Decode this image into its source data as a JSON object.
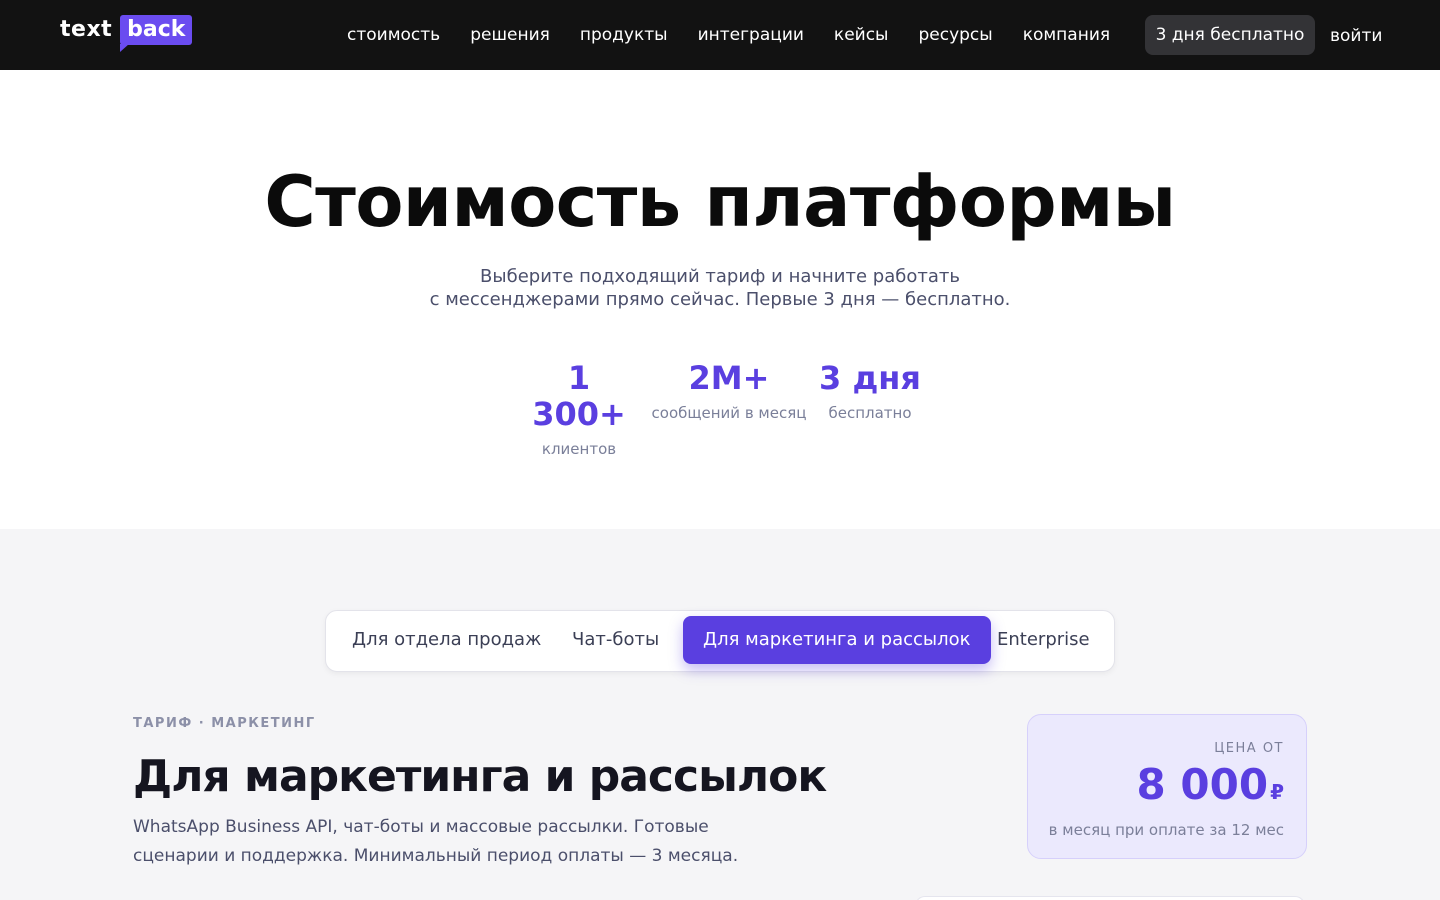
{
  "header": {
    "logo_text": "text",
    "logo_highlight": "back",
    "nav": [
      "стоимость",
      "решения",
      "продукты",
      "интеграции",
      "кейсы",
      "ресурсы",
      "компания"
    ],
    "trial_button": "3 дня бесплатно",
    "login": "войти"
  },
  "hero": {
    "title": "Стоимость платформы",
    "subtitle_line1": "Выберите подходящий тариф и начните работать",
    "subtitle_line2": "с мессенджерами прямо сейчас. Первые 3 дня — бесплатно.",
    "stats": [
      {
        "value": "1 300+",
        "label": "клиентов"
      },
      {
        "value": "2M+",
        "label": "сообщений в месяц"
      },
      {
        "value": "3 дня",
        "label": "бесплатно"
      }
    ]
  },
  "pricing": {
    "tabs": [
      "Для отдела продаж",
      "Чат-боты",
      "Для маркетинга и рассылок",
      "Enterprise"
    ],
    "active_tab": 2,
    "plan": {
      "kicker": "ТАРИФ · МАРКЕТИНГ",
      "title": "Для маркетинга и рассылок",
      "description": "WhatsApp Business API, чат-боты и массовые рассылки. Готовые сценарии и поддержка. Минимальный период оплаты — 3 месяца."
    },
    "price": {
      "label": "ЦЕНА ОТ",
      "value": "8 000",
      "currency": "₽",
      "note": "в месяц при оплате за 12 мес"
    }
  },
  "colors": {
    "accent": "#5a3fe0",
    "header_bg": "#121212",
    "section_bg": "#f5f5f7"
  }
}
